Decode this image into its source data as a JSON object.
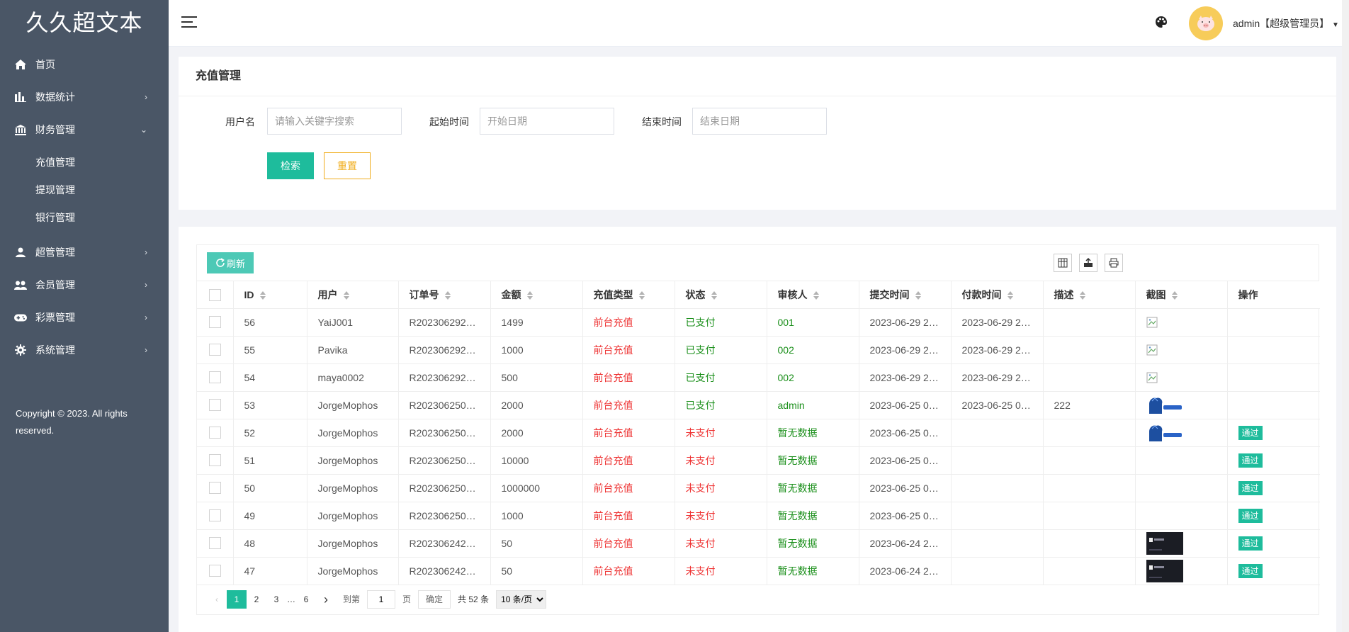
{
  "brand": "久久超文本",
  "sidebar": {
    "items": [
      {
        "label": "首页",
        "icon": "home-icon"
      },
      {
        "label": "数据统计",
        "icon": "bar-chart-icon"
      },
      {
        "label": "财务管理",
        "icon": "bank-icon"
      },
      {
        "label": "超管管理",
        "icon": "user-icon"
      },
      {
        "label": "会员管理",
        "icon": "users-icon"
      },
      {
        "label": "彩票管理",
        "icon": "gamepad-icon"
      },
      {
        "label": "系统管理",
        "icon": "gear-icon"
      }
    ],
    "submenu": [
      "充值管理",
      "提现管理",
      "银行管理"
    ],
    "copyright": "Copyright © 2023. All rights reserved."
  },
  "header": {
    "user": "admin【超级管理员】"
  },
  "search": {
    "title": "充值管理",
    "username_label": "用户名",
    "username_placeholder": "请输入关键字搜索",
    "start_label": "起始时间",
    "start_placeholder": "开始日期",
    "end_label": "结束时间",
    "end_placeholder": "结束日期",
    "search_btn": "检索",
    "reset_btn": "重置"
  },
  "table": {
    "refresh": "刷新",
    "columns": [
      "ID",
      "用户",
      "订单号",
      "金额",
      "充值类型",
      "状态",
      "审核人",
      "提交时间",
      "付款时间",
      "描述",
      "截图",
      "操作"
    ],
    "rows": [
      {
        "id": "56",
        "user": "YaiJ001",
        "order": "R202306292…",
        "amount": "1499",
        "type": "前台充值",
        "status": "已支付",
        "reviewer": "001",
        "submit": "2023-06-29 2…",
        "paid": "2023-06-29 2…",
        "desc": "",
        "shot": "broken",
        "action": ""
      },
      {
        "id": "55",
        "user": "Pavika",
        "order": "R202306292…",
        "amount": "1000",
        "type": "前台充值",
        "status": "已支付",
        "reviewer": "002",
        "submit": "2023-06-29 2…",
        "paid": "2023-06-29 2…",
        "desc": "",
        "shot": "broken",
        "action": ""
      },
      {
        "id": "54",
        "user": "maya0002",
        "order": "R202306292…",
        "amount": "500",
        "type": "前台充值",
        "status": "已支付",
        "reviewer": "002",
        "submit": "2023-06-29 2…",
        "paid": "2023-06-29 2…",
        "desc": "",
        "shot": "broken",
        "action": ""
      },
      {
        "id": "53",
        "user": "JorgeMophos",
        "order": "R202306250…",
        "amount": "2000",
        "type": "前台充值",
        "status": "已支付",
        "reviewer": "admin",
        "submit": "2023-06-25 0…",
        "paid": "2023-06-25 0…",
        "desc": "222",
        "shot": "blue",
        "action": ""
      },
      {
        "id": "52",
        "user": "JorgeMophos",
        "order": "R202306250…",
        "amount": "2000",
        "type": "前台充值",
        "status": "未支付",
        "reviewer": "暂无数据",
        "submit": "2023-06-25 0…",
        "paid": "",
        "desc": "",
        "shot": "blue",
        "action": "通过"
      },
      {
        "id": "51",
        "user": "JorgeMophos",
        "order": "R202306250…",
        "amount": "10000",
        "type": "前台充值",
        "status": "未支付",
        "reviewer": "暂无数据",
        "submit": "2023-06-25 0…",
        "paid": "",
        "desc": "",
        "shot": "",
        "action": "通过"
      },
      {
        "id": "50",
        "user": "JorgeMophos",
        "order": "R202306250…",
        "amount": "1000000",
        "type": "前台充值",
        "status": "未支付",
        "reviewer": "暂无数据",
        "submit": "2023-06-25 0…",
        "paid": "",
        "desc": "",
        "shot": "",
        "action": "通过"
      },
      {
        "id": "49",
        "user": "JorgeMophos",
        "order": "R202306250…",
        "amount": "1000",
        "type": "前台充值",
        "status": "未支付",
        "reviewer": "暂无数据",
        "submit": "2023-06-25 0…",
        "paid": "",
        "desc": "",
        "shot": "",
        "action": "通过"
      },
      {
        "id": "48",
        "user": "JorgeMophos",
        "order": "R202306242…",
        "amount": "50",
        "type": "前台充值",
        "status": "未支付",
        "reviewer": "暂无数据",
        "submit": "2023-06-24 2…",
        "paid": "",
        "desc": "",
        "shot": "dark",
        "action": "通过"
      },
      {
        "id": "47",
        "user": "JorgeMophos",
        "order": "R202306242…",
        "amount": "50",
        "type": "前台充值",
        "status": "未支付",
        "reviewer": "暂无数据",
        "submit": "2023-06-24 2…",
        "paid": "",
        "desc": "",
        "shot": "dark",
        "action": "通过"
      }
    ]
  },
  "pager": {
    "pages": [
      "1",
      "2",
      "3",
      "…",
      "6"
    ],
    "goto": "到第",
    "page_value": "1",
    "page_unit": "页",
    "ok": "确定",
    "total": "共 52 条",
    "per_page": "10 条/页"
  },
  "colors": {
    "accent": "#1ebc9c",
    "sidebar": "#4a5666",
    "warning": "#f0ad1c",
    "danger": "#e33",
    "success": "#1a8f1a"
  }
}
